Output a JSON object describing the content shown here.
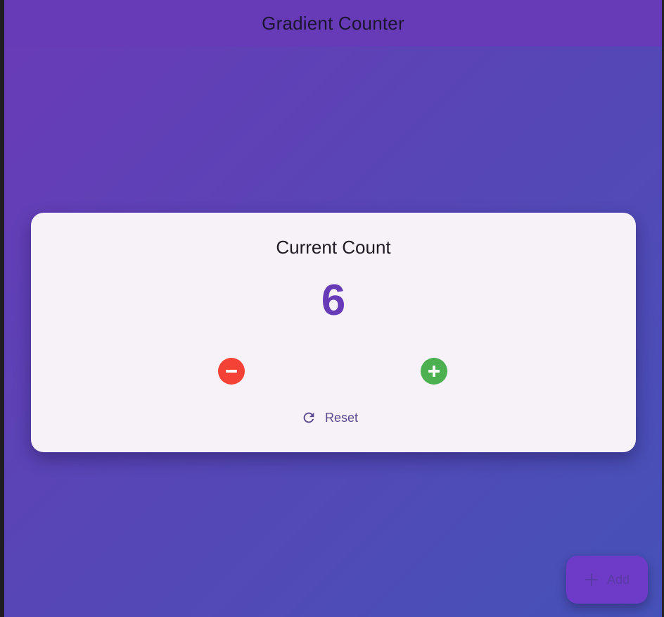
{
  "app_bar": {
    "title": "Gradient Counter"
  },
  "counter_card": {
    "title": "Current Count",
    "count": "6",
    "decrement_icon": "remove-circle-icon",
    "increment_icon": "add-circle-icon",
    "reset_icon": "refresh-icon",
    "reset_label": "Reset"
  },
  "fab": {
    "icon": "plus-icon",
    "label": "Add"
  },
  "colors": {
    "app_bar": "#673ab7",
    "gradient_start": "#6a3ab7",
    "gradient_end": "#4552b7",
    "card": "#f7f1f8",
    "count": "#673ab7",
    "decrement": "#f44336",
    "increment": "#4caf50",
    "fab": "#6e3bc8"
  }
}
